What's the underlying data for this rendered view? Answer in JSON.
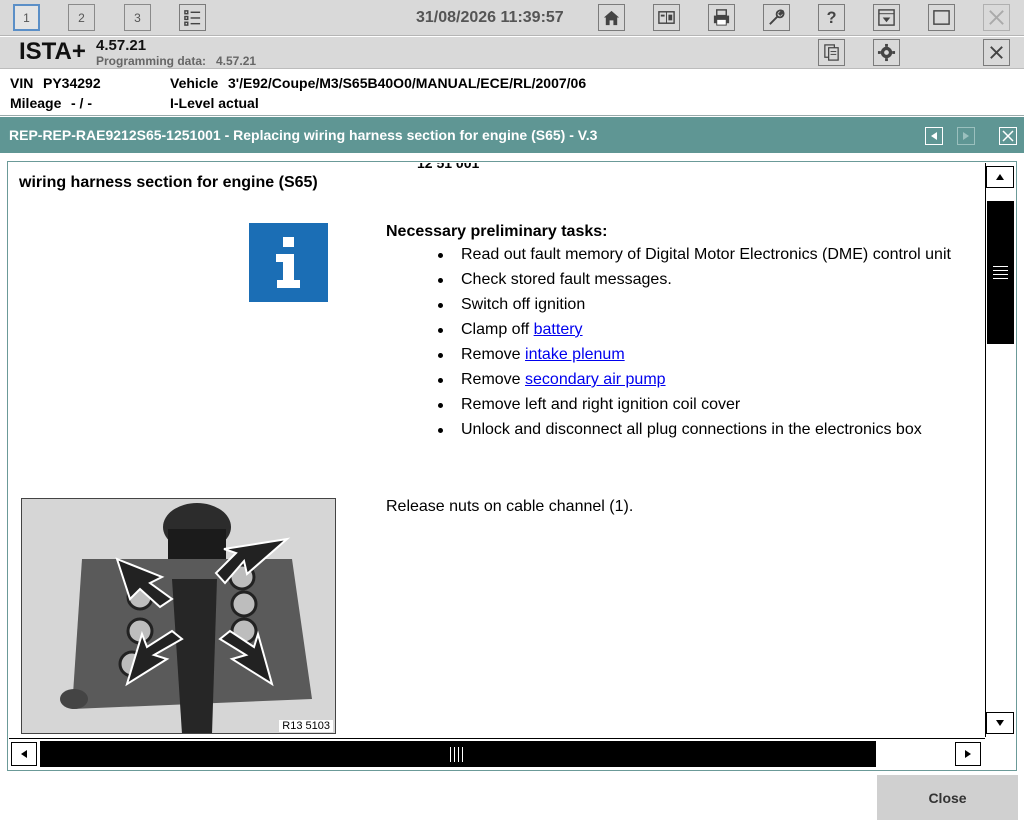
{
  "toolbar": {
    "tabs": [
      "1",
      "2",
      "3"
    ],
    "datetime": "31/08/2026 11:39:57",
    "icons": [
      "list-icon",
      "home-icon",
      "compare-icon",
      "print-icon",
      "wrench-icon",
      "help-icon",
      "download-icon",
      "window-icon",
      "close-icon"
    ]
  },
  "app": {
    "name": "ISTA+",
    "version": "4.57.21",
    "programming_label": "Programming data:",
    "programming_value": "4.57.21"
  },
  "vehicle": {
    "vin_label": "VIN",
    "vin": "PY34292",
    "vehicle_label": "Vehicle",
    "vehicle": "3'/E92/Coupe/M3/S65B40O0/MANUAL/ECE/RL/2007/06",
    "mileage_label": "Mileage",
    "mileage": "- / -",
    "ilevel_label": "I-Level actual"
  },
  "document": {
    "title": "REP-REP-RAE9212S65-1251001 - Replacing wiring harness section for engine (S65) - V.3",
    "cut_text": "12 51 001",
    "heading": "wiring harness section for engine (S65)",
    "prelim_heading": "Necessary preliminary tasks:",
    "tasks": [
      {
        "text": "Read out fault memory of Digital Motor Electronics (DME) control unit",
        "link": ""
      },
      {
        "text": "Check stored fault messages.",
        "link": ""
      },
      {
        "text": "Switch off ignition",
        "link": ""
      },
      {
        "text": "Clamp off ",
        "link": "battery"
      },
      {
        "text": "Remove ",
        "link": "intake plenum"
      },
      {
        "text": "Remove ",
        "link": "secondary air pump"
      },
      {
        "text": "Remove left and right ignition coil cover",
        "link": ""
      },
      {
        "text": "Unlock and disconnect all plug connections in the electronics box",
        "link": ""
      }
    ],
    "step_text": "Release nuts on cable channel (1).",
    "image_label": "R13 5103"
  },
  "footer": {
    "close_label": "Close"
  },
  "colors": {
    "title_bar": "#5f9694",
    "info_icon": "#1b6eb5",
    "link": "#0000ee"
  }
}
